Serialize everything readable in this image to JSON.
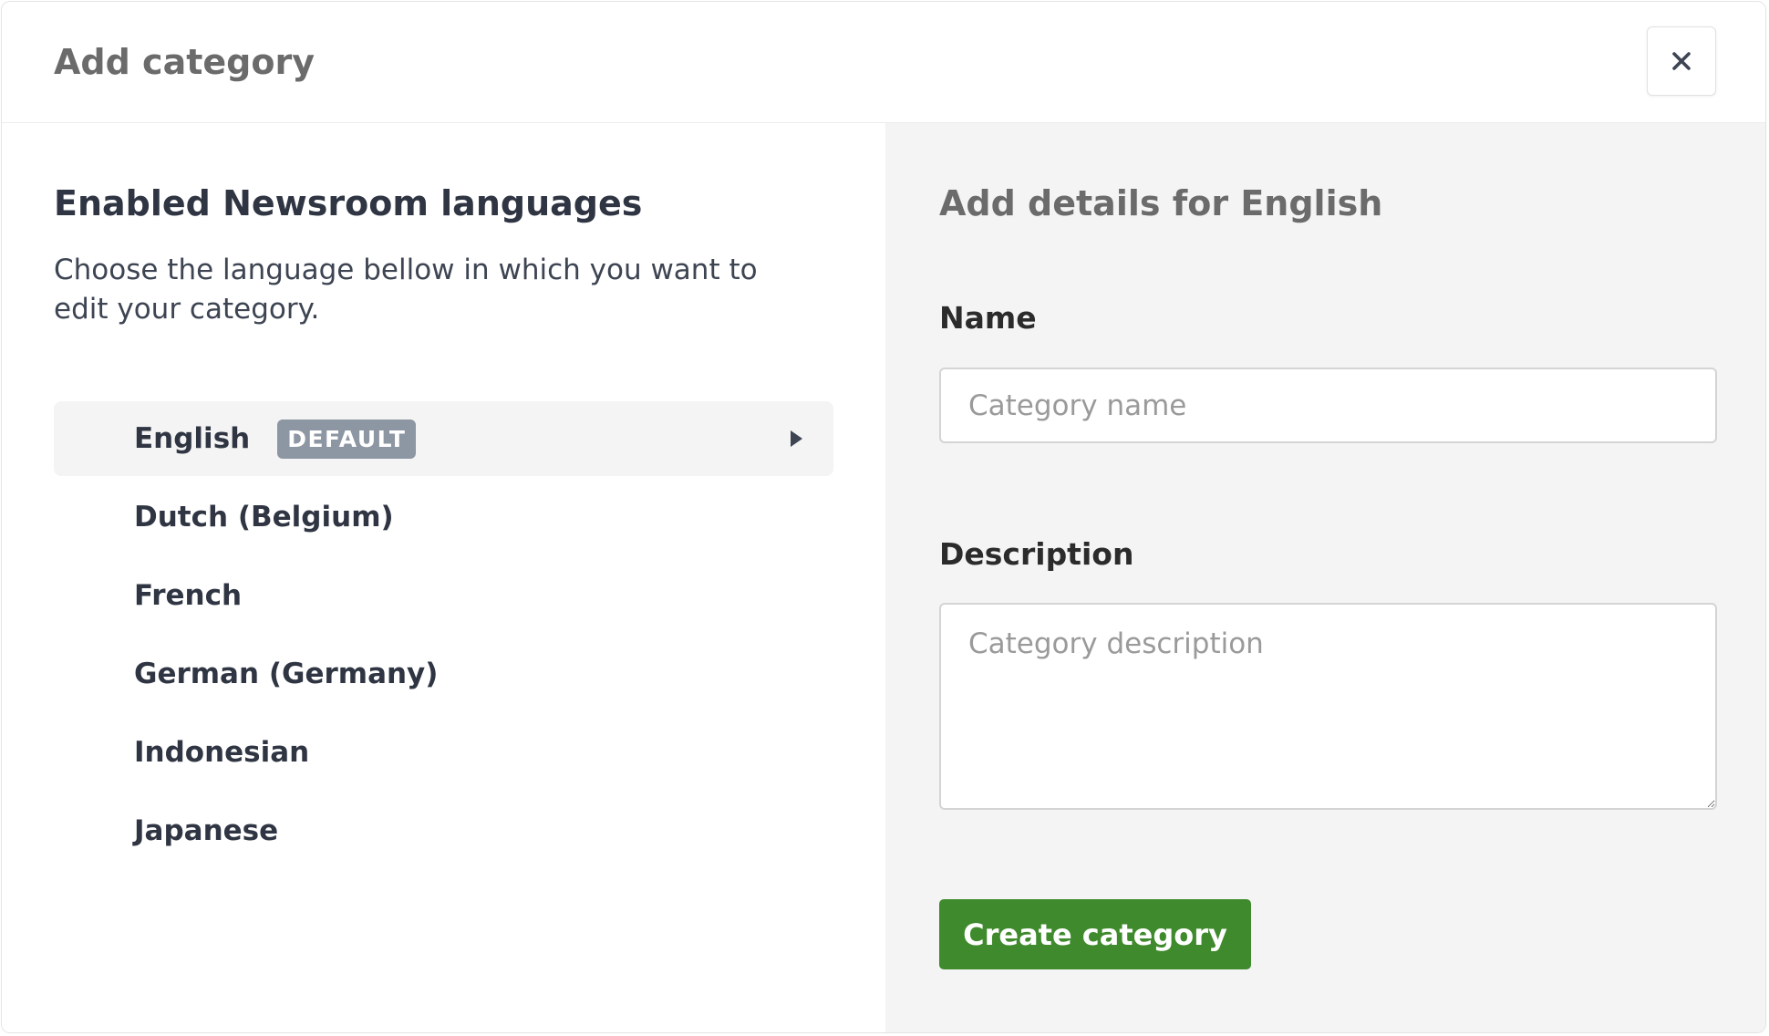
{
  "modal": {
    "title": "Add category",
    "close_icon": "close-icon"
  },
  "languages": {
    "title": "Enabled Newsroom languages",
    "description": "Choose the language bellow in which you want to edit your category.",
    "items": [
      {
        "label": "English",
        "badge": "DEFAULT",
        "selected": true
      },
      {
        "label": "Dutch (Belgium)"
      },
      {
        "label": "French"
      },
      {
        "label": "German (Germany)"
      },
      {
        "label": "Indonesian"
      },
      {
        "label": "Japanese"
      }
    ]
  },
  "details": {
    "title": "Add details for English",
    "name_label": "Name",
    "name_placeholder": "Category name",
    "name_value": "",
    "description_label": "Description",
    "description_placeholder": "Category description",
    "description_value": "",
    "submit_label": "Create category"
  },
  "colors": {
    "accent": "#3f8a2c",
    "badge": "#8d96a3",
    "panel_background": "#f4f4f4",
    "heading": "#2f3542"
  }
}
